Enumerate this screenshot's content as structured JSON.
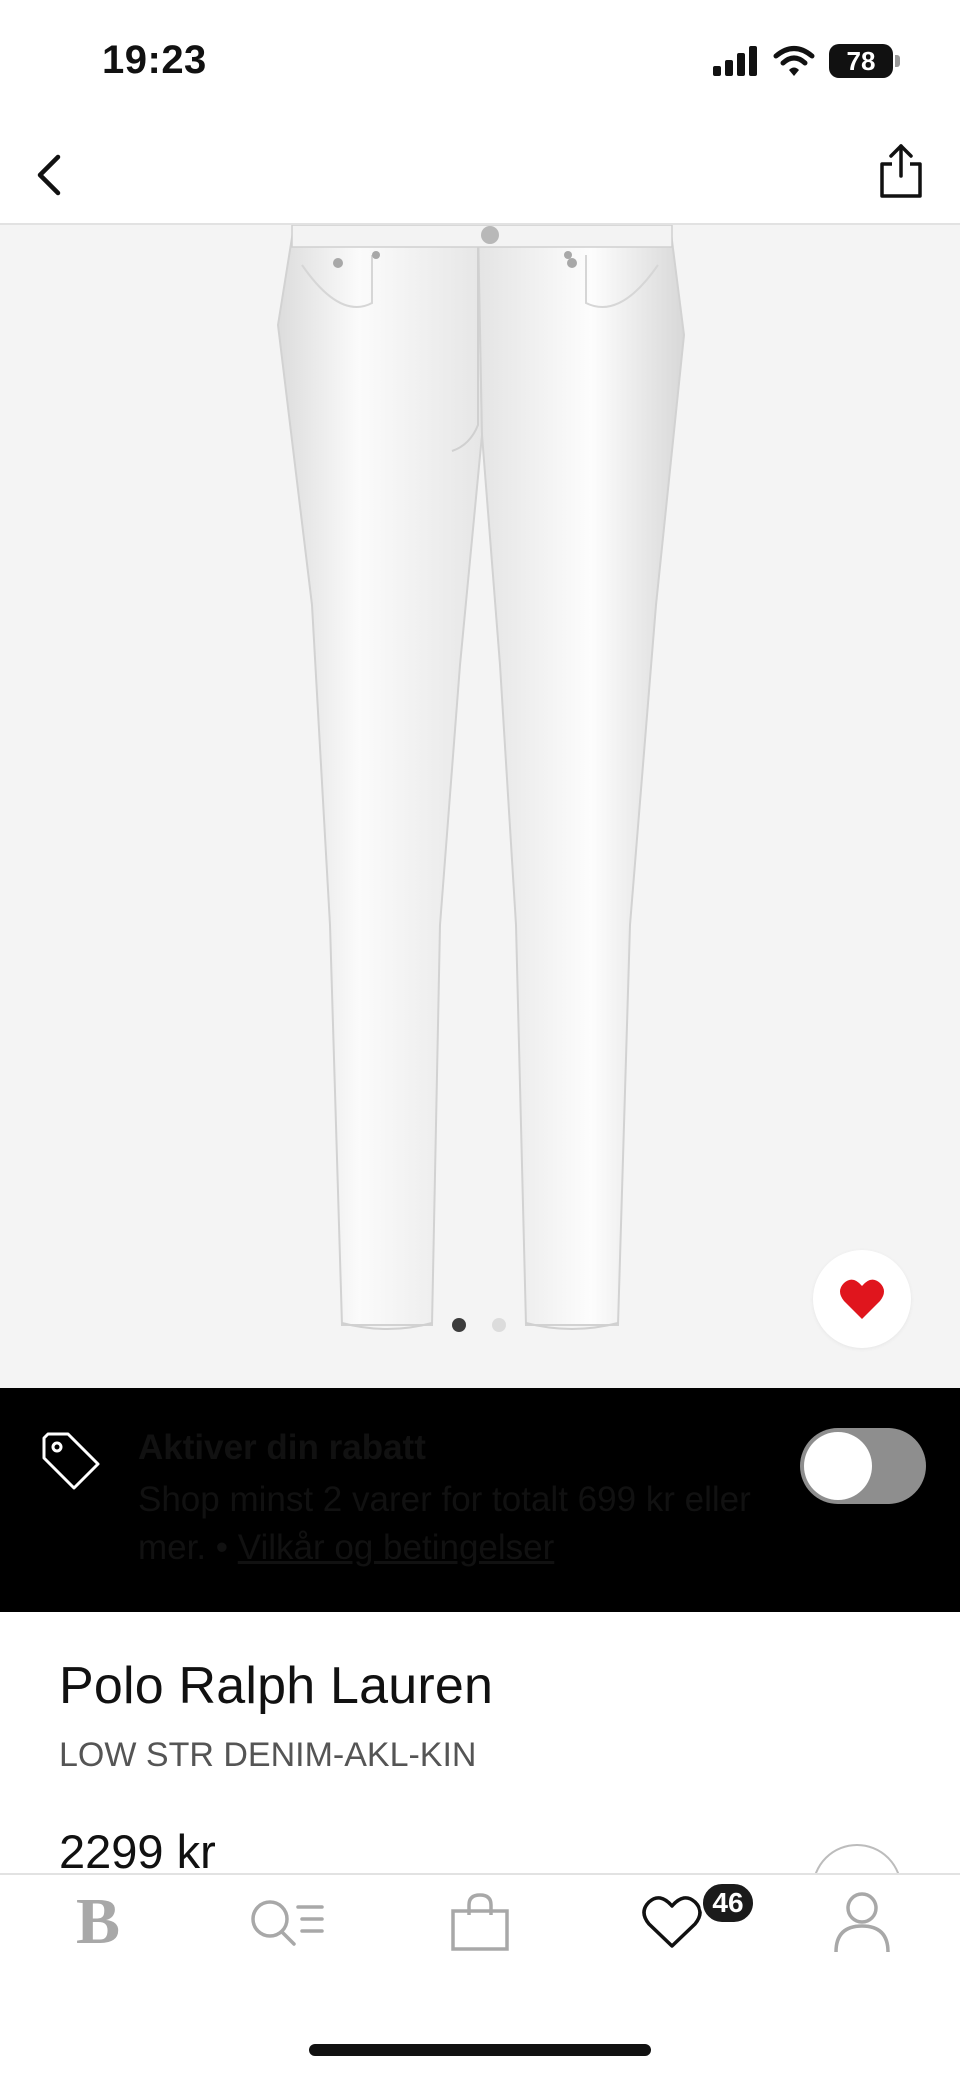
{
  "status_bar": {
    "time": "19:23",
    "battery": "78"
  },
  "header": {
    "back_icon": "chevron-left-icon",
    "share_icon": "share-icon"
  },
  "product_image": {
    "alt": "White slim jeans",
    "dots": 2,
    "active_dot": 1,
    "favorite_icon": "heart-icon",
    "favorite_color": "#e0151d"
  },
  "banner": {
    "title": "Aktiver din rabatt",
    "body": "Shop minst 2 varer for totalt 699 kr eller mer. •",
    "link": "Vilkår og betingelser",
    "toggle_on": false
  },
  "product": {
    "brand": "Polo Ralph Lauren",
    "model": "LOW STR DENIM-AKL-KIN",
    "price": "2299 kr"
  },
  "tab_bar": {
    "home_logo": "B",
    "favorites_count": "46",
    "icons": [
      "brand-logo-icon",
      "search-list-icon",
      "shopping-bag-icon",
      "heart-icon",
      "user-icon"
    ]
  },
  "colors": {
    "banner_bg": "#000000",
    "accent": "#e0151d",
    "image_bg": "#f4f4f4"
  }
}
